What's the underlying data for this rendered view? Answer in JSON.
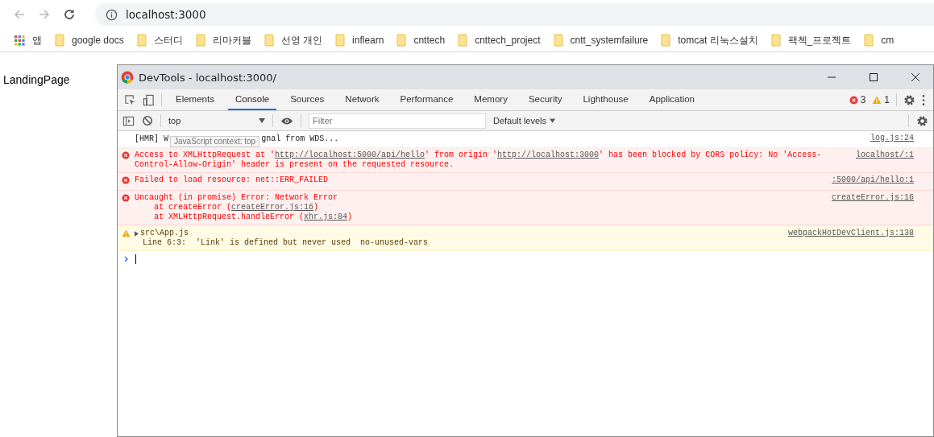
{
  "browser": {
    "address": "localhost:3000",
    "bookmarks": [
      {
        "label": "앱",
        "kind": "apps"
      },
      {
        "label": "google docs",
        "kind": "folder"
      },
      {
        "label": "스터디",
        "kind": "folder"
      },
      {
        "label": "리마커블",
        "kind": "folder"
      },
      {
        "label": "선영 개인",
        "kind": "folder"
      },
      {
        "label": "inflearn",
        "kind": "folder"
      },
      {
        "label": "cnttech",
        "kind": "folder"
      },
      {
        "label": "cnttech_project",
        "kind": "folder"
      },
      {
        "label": "cntt_systemfailure",
        "kind": "folder"
      },
      {
        "label": "tomcat 리눅스설치",
        "kind": "folder"
      },
      {
        "label": "팩첵_프로젝트",
        "kind": "folder"
      },
      {
        "label": "cm",
        "kind": "folder"
      }
    ]
  },
  "page": {
    "text": "LandingPage"
  },
  "devtools": {
    "title": "DevTools - localhost:3000/",
    "tabs": [
      {
        "label": "Elements",
        "selected": false
      },
      {
        "label": "Console",
        "selected": true
      },
      {
        "label": "Sources",
        "selected": false
      },
      {
        "label": "Network",
        "selected": false
      },
      {
        "label": "Performance",
        "selected": false
      },
      {
        "label": "Memory",
        "selected": false
      },
      {
        "label": "Security",
        "selected": false
      },
      {
        "label": "Lighthouse",
        "selected": false
      },
      {
        "label": "Application",
        "selected": false
      }
    ],
    "error_count": "3",
    "warning_count": "1",
    "context": "top",
    "filter": {
      "placeholder": "Filter"
    },
    "levels": "Default levels",
    "messages": [
      {
        "kind": "info",
        "parts": [
          {
            "text": "[HMR] W",
            "kind": "text"
          },
          {
            "text": "gnal from WDS...",
            "kind": "text"
          }
        ],
        "tooltip": "JavaScript context: top",
        "source": "log.js:24"
      },
      {
        "kind": "error",
        "parts": [
          {
            "text": "Access to XMLHttpRequest at '",
            "kind": "text"
          },
          {
            "text": "http://localhost:5000/api/hello",
            "kind": "link"
          },
          {
            "text": "' from origin '",
            "kind": "text"
          },
          {
            "text": "http://localhost:3000",
            "kind": "link"
          },
          {
            "text": "' has been blocked by CORS policy: No 'Access-Control-Allow-Origin' header is present on the requested resource.",
            "kind": "text"
          }
        ],
        "source": "localhost/:1"
      },
      {
        "kind": "error",
        "parts": [
          {
            "text": "Failed to load resource: net::ERR_FAILED",
            "kind": "text"
          }
        ],
        "source": ":5000/api/hello:1"
      },
      {
        "kind": "error",
        "parts": [
          {
            "text": "Uncaught (in promise) Error: Network Error",
            "kind": "text"
          }
        ],
        "trace": [
          [
            {
              "text": "at createError (",
              "kind": "text"
            },
            {
              "text": "createError.js:16",
              "kind": "link"
            },
            {
              "text": ")",
              "kind": "text"
            }
          ],
          [
            {
              "text": "at XMLHttpRequest.handleError (",
              "kind": "text"
            },
            {
              "text": "xhr.js:84",
              "kind": "link"
            },
            {
              "text": ")",
              "kind": "text"
            }
          ]
        ],
        "source": "createError.js:16"
      },
      {
        "kind": "warning",
        "expandable": true,
        "parts": [
          {
            "text": "src\\App.js",
            "kind": "text"
          }
        ],
        "detail": "Line 6:3:  'Link' is defined but never used  no-unused-vars",
        "source": "webpackHotDevClient.js:138"
      }
    ]
  }
}
